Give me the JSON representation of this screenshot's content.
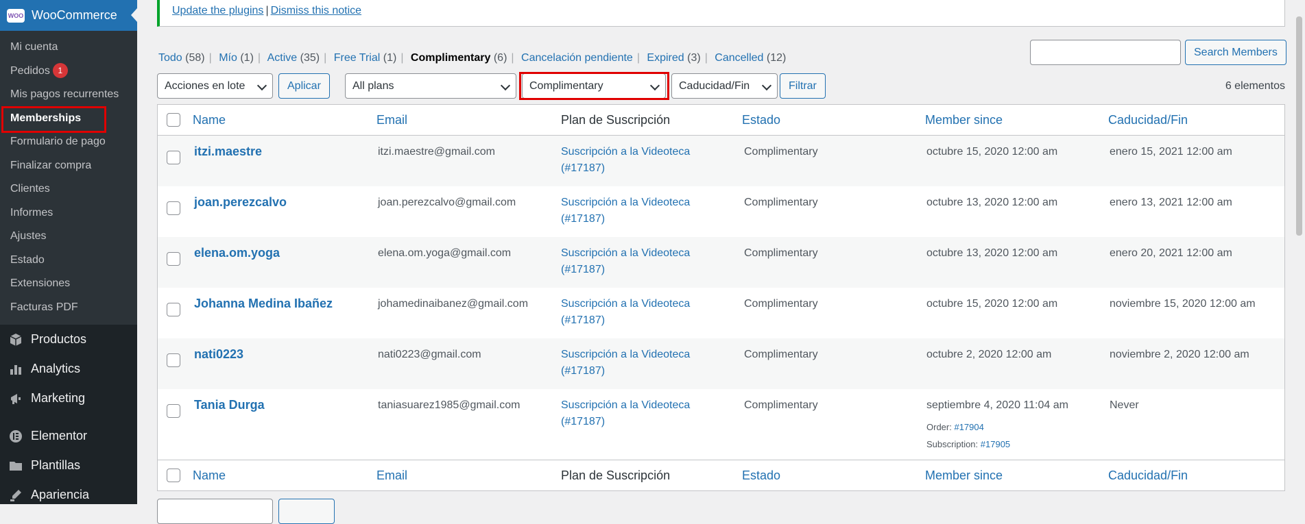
{
  "sidebar": {
    "header": {
      "logo_text": "WOO",
      "title": "WooCommerce"
    },
    "submenu": [
      {
        "label": "Mi cuenta"
      },
      {
        "label": "Pedidos",
        "badge": "1"
      },
      {
        "label": "Mis pagos recurrentes"
      },
      {
        "label": "Memberships",
        "current": true
      },
      {
        "label": "Formulario de pago"
      },
      {
        "label": "Finalizar compra"
      },
      {
        "label": "Clientes"
      },
      {
        "label": "Informes"
      },
      {
        "label": "Ajustes"
      },
      {
        "label": "Estado"
      },
      {
        "label": "Extensiones"
      },
      {
        "label": "Facturas PDF"
      }
    ],
    "menu": [
      {
        "label": "Productos",
        "icon": "products-icon"
      },
      {
        "label": "Analytics",
        "icon": "analytics-icon"
      },
      {
        "label": "Marketing",
        "icon": "marketing-icon"
      },
      {
        "label": "Elementor",
        "icon": "elementor-icon"
      },
      {
        "label": "Plantillas",
        "icon": "folder-icon"
      },
      {
        "label": "Apariencia",
        "icon": "appearance-icon"
      }
    ]
  },
  "notice": {
    "update_link": "Update the plugins",
    "separator": "|",
    "dismiss_link": "Dismiss this notice"
  },
  "views": [
    {
      "label": "Todo",
      "count": "(58)"
    },
    {
      "label": "Mío",
      "count": "(1)"
    },
    {
      "label": "Active",
      "count": "(35)"
    },
    {
      "label": "Free Trial",
      "count": "(1)"
    },
    {
      "label": "Complimentary",
      "count": "(6)",
      "current": true
    },
    {
      "label": "Cancelación pendiente",
      "count": ""
    },
    {
      "label": "Expired",
      "count": "(3)"
    },
    {
      "label": "Cancelled",
      "count": "(12)"
    }
  ],
  "search": {
    "value": "",
    "button": "Search Members"
  },
  "tablenav": {
    "bulk_action": "Acciones en lote",
    "apply": "Aplicar",
    "plan_filter": "All plans",
    "status_filter": "Complimentary",
    "expiry_filter": "Caducidad/Fin",
    "filter_button": "Filtrar",
    "items_count": "6 elementos"
  },
  "table": {
    "columns": [
      "Name",
      "Email",
      "Plan de Suscripción",
      "Estado",
      "Member since",
      "Caducidad/Fin"
    ],
    "rows": [
      {
        "name": "itzi.maestre",
        "email": "itzi.maestre@gmail.com",
        "plan_line1": "Suscripción a la Videoteca",
        "plan_line2": "(#17187)",
        "status": "Complimentary",
        "since": "octubre 15, 2020 12:00 am",
        "expires": "enero 15, 2021 12:00 am"
      },
      {
        "name": "joan.perezcalvo",
        "email": "joan.perezcalvo@gmail.com",
        "plan_line1": "Suscripción a la Videoteca",
        "plan_line2": "(#17187)",
        "status": "Complimentary",
        "since": "octubre 13, 2020 12:00 am",
        "expires": "enero 13, 2021 12:00 am"
      },
      {
        "name": "elena.om.yoga",
        "email": "elena.om.yoga@gmail.com",
        "plan_line1": "Suscripción a la Videoteca",
        "plan_line2": "(#17187)",
        "status": "Complimentary",
        "since": "octubre 13, 2020 12:00 am",
        "expires": "enero 20, 2021 12:00 am"
      },
      {
        "name": "Johanna Medina Ibañez",
        "email": "johamedinaibanez@gmail.com",
        "plan_line1": "Suscripción a la Videoteca",
        "plan_line2": "(#17187)",
        "status": "Complimentary",
        "since": "octubre 15, 2020 12:00 am",
        "expires": "noviembre 15, 2020 12:00 am"
      },
      {
        "name": "nati0223",
        "email": "nati0223@gmail.com",
        "plan_line1": "Suscripción a la Videoteca",
        "plan_line2": "(#17187)",
        "status": "Complimentary",
        "since": "octubre 2, 2020 12:00 am",
        "expires": "noviembre 2, 2020 12:00 am"
      },
      {
        "name": "Tania Durga",
        "email": "taniasuarez1985@gmail.com",
        "plan_line1": "Suscripción a la Videoteca",
        "plan_line2": "(#17187)",
        "status": "Complimentary",
        "since": "septiembre 4, 2020 11:04 am",
        "expires": "Never",
        "order_label": "Order:",
        "order_link": "#17904",
        "subscription_label": "Subscription:",
        "subscription_link": "#17905"
      }
    ]
  }
}
